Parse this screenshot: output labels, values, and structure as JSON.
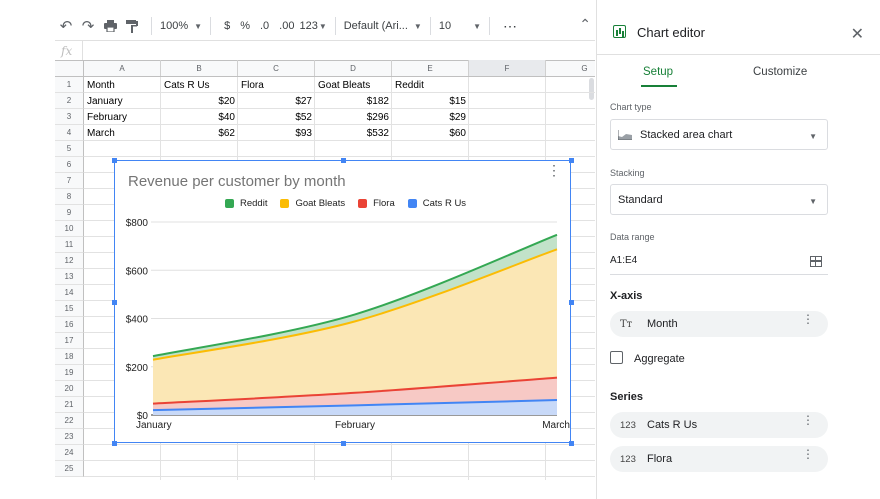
{
  "toolbar": {
    "zoom": "100%",
    "currency": "$",
    "percent": "%",
    "dec_less": ".0",
    "dec_more": ".00",
    "number_format": "123",
    "font": "Default (Ari...",
    "font_size": "10",
    "more": "⋯"
  },
  "formula_bar": {
    "label": "fx"
  },
  "sheet": {
    "columns": [
      "A",
      "B",
      "C",
      "D",
      "E",
      "F",
      "G"
    ],
    "rows": [
      "1",
      "2",
      "3",
      "4",
      "5",
      "6",
      "7",
      "8",
      "9",
      "10",
      "11",
      "12",
      "13",
      "14",
      "15",
      "16",
      "17",
      "18",
      "19",
      "20",
      "21",
      "22",
      "23",
      "24",
      "25"
    ],
    "header": [
      "Month",
      "Cats R Us",
      "Flora",
      "Goat Bleats",
      "Reddit"
    ],
    "data": [
      [
        "January",
        "$20",
        "$27",
        "$182",
        "$15"
      ],
      [
        "February",
        "$40",
        "$52",
        "$296",
        "$29"
      ],
      [
        "March",
        "$62",
        "$93",
        "$532",
        "$60"
      ]
    ]
  },
  "chart": {
    "legend": [
      {
        "name": "Reddit",
        "color": "#34a853"
      },
      {
        "name": "Goat Bleats",
        "color": "#fbbc04"
      },
      {
        "name": "Flora",
        "color": "#ea4335"
      },
      {
        "name": "Cats R Us",
        "color": "#4285f4"
      }
    ]
  },
  "chart_data": {
    "type": "area",
    "stacking": "standard",
    "title": "Revenue per customer by month",
    "categories": [
      "January",
      "February",
      "March"
    ],
    "series": [
      {
        "name": "Cats R Us",
        "values": [
          20,
          40,
          62
        ],
        "color": "#4285f4",
        "fill": "#c8d9f8"
      },
      {
        "name": "Flora",
        "values": [
          27,
          52,
          93
        ],
        "color": "#ea4335",
        "fill": "#f7c9c5"
      },
      {
        "name": "Goat Bleats",
        "values": [
          182,
          296,
          532
        ],
        "color": "#fbbc04",
        "fill": "#fbe7b5"
      },
      {
        "name": "Reddit",
        "values": [
          15,
          29,
          60
        ],
        "color": "#34a853",
        "fill": "#c2e2c9"
      }
    ],
    "ylim": [
      0,
      800
    ],
    "yticks": [
      0,
      200,
      400,
      600,
      800
    ],
    "ytick_labels": [
      "$0",
      "$200",
      "$400",
      "$600",
      "$800"
    ],
    "grid": true,
    "legend_position": "top"
  },
  "panel": {
    "title": "Chart editor",
    "tab_setup": "Setup",
    "tab_customize": "Customize",
    "chart_type_label": "Chart type",
    "chart_type_value": "Stacked area chart",
    "stacking_label": "Stacking",
    "stacking_value": "Standard",
    "data_range_label": "Data range",
    "data_range_value": "A1:E4",
    "x_axis_heading": "X-axis",
    "x_axis_value": "Month",
    "x_axis_icon": "Tт",
    "aggregate_label": "Aggregate",
    "series_heading": "Series",
    "series_icon": "123",
    "series": [
      "Cats R Us",
      "Flora"
    ]
  }
}
